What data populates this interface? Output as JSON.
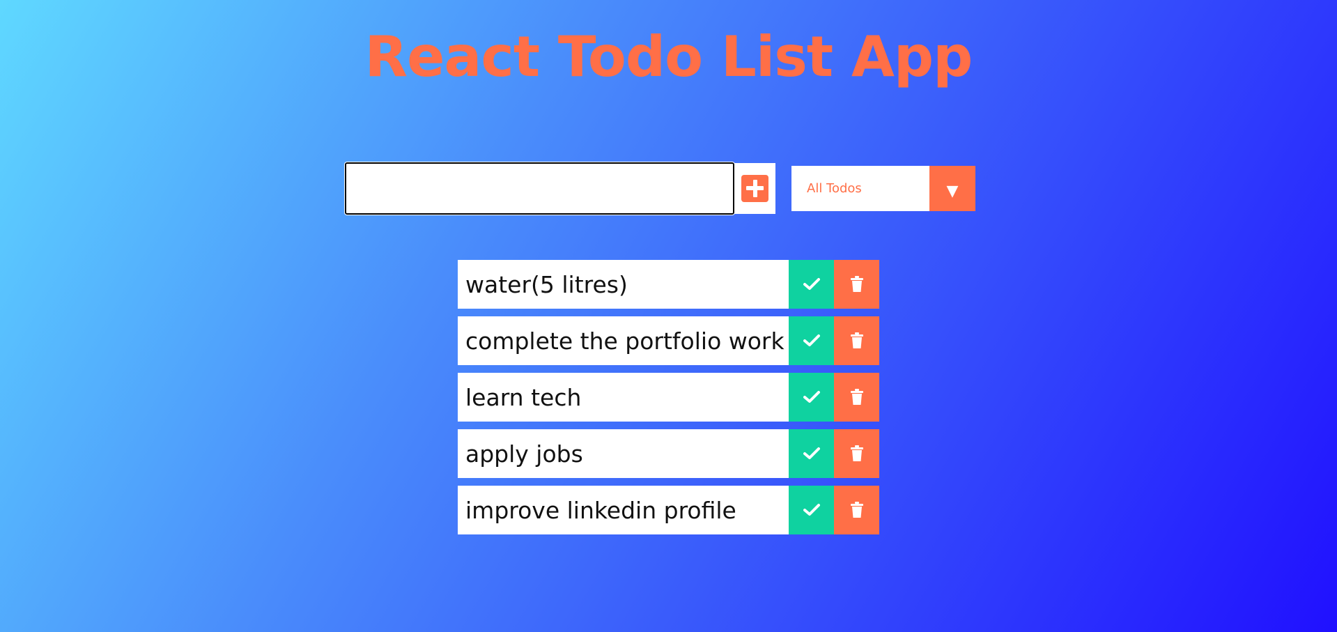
{
  "header": {
    "title": "React Todo List App"
  },
  "form": {
    "input_value": "",
    "add_icon": "plus-square-icon"
  },
  "filter": {
    "selected": "All Todos",
    "arrow_glyph": "▼"
  },
  "todos": [
    {
      "text": "water(5 litres)"
    },
    {
      "text": "complete the portfolio work"
    },
    {
      "text": "learn tech"
    },
    {
      "text": "apply jobs"
    },
    {
      "text": "improve linkedin profile"
    }
  ],
  "icons": {
    "complete": "check-icon",
    "delete": "trash-icon"
  },
  "colors": {
    "accent": "#ff6f47",
    "complete": "#0fd2a0",
    "bg_start": "#5fd8ff",
    "bg_end": "#2010ff"
  }
}
